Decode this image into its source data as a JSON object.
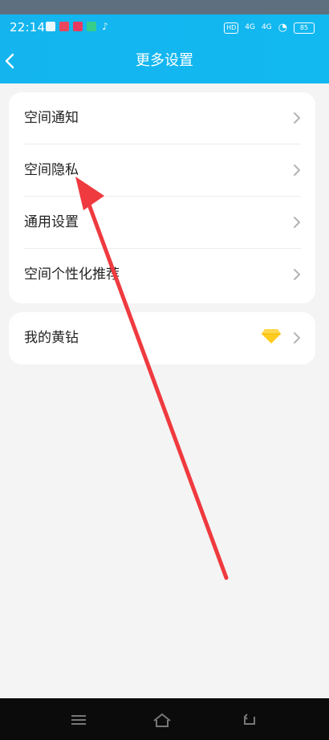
{
  "status_bar": {
    "time": "22:14",
    "network_labels": [
      "4G",
      "4G"
    ],
    "hd_label": "HD",
    "battery": "85"
  },
  "header": {
    "title": "更多设置"
  },
  "settings_card": {
    "items": [
      {
        "label": "空间通知"
      },
      {
        "label": "空间隐私"
      },
      {
        "label": "通用设置"
      },
      {
        "label": "空间个性化推荐"
      }
    ]
  },
  "vip_card": {
    "label": "我的黄钻"
  },
  "colors": {
    "header_blue": "#12b8f0",
    "annotation_red": "#ef3a3f",
    "diamond_yellow": "#ffcc1f"
  },
  "icons": {
    "back": "chevron-left-icon",
    "row_arrow": "chevron-right-icon",
    "vip": "yellow-diamond-icon",
    "nav_menu": "menu-icon",
    "nav_home": "home-icon",
    "nav_back": "back-icon"
  }
}
